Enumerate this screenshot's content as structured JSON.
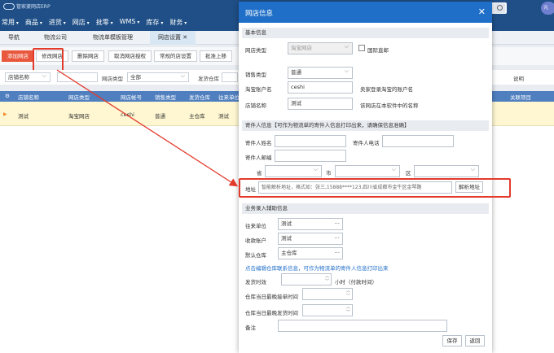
{
  "app": {
    "logo_text": "管家婆网店ERP",
    "avatar_text": "元"
  },
  "topnav": [
    "常用",
    "商品",
    "进货",
    "网店",
    "批零",
    "WMS",
    "库存",
    "财务"
  ],
  "tabs": [
    "导航",
    "物流公司",
    "物流单模板管理",
    "网店设置"
  ],
  "toolbar": {
    "add": "添加网店",
    "edit": "修改网店",
    "delete": "删除网店",
    "cancel_auth": "取消网店授权",
    "hint": "常规的店设置",
    "auth": "批准上移"
  },
  "filters": {
    "shop_name_select": "店铺名称",
    "shop_type_label": "网店类型",
    "shop_type_value": "全部",
    "warehouse_label": "发货仓库",
    "right_label": "说明"
  },
  "grid": {
    "headers": [
      "店铺名称",
      "网店类型",
      "网店帐号",
      "销售类型",
      "发货仓库",
      "往来单位",
      "关联项目"
    ],
    "row": {
      "name": "测试",
      "type": "淘宝网店",
      "account": "ceshi",
      "sale": "普通",
      "warehouse": "主仓库",
      "unit": "测试"
    }
  },
  "modal": {
    "title": "网店信息",
    "basic": {
      "section": "基本信息",
      "type_label": "网店类型",
      "type_value": "淘宝网店",
      "intl_label": "国际直邮",
      "sale_label": "销售类型",
      "sale_value": "普通",
      "account_label": "淘宝账户名",
      "account_value": "ceshi",
      "account_hint": "卖家登录淘宝的账户名",
      "shop_label": "店铺名称",
      "shop_value": "测试",
      "shop_hint": "该网店在本软件中的名称"
    },
    "sender": {
      "section": "寄件人信息【可作为物流单的寄件人信息打印出来，请确保信息准确】",
      "name_label": "寄件人姓名",
      "phone_label": "寄件人电话",
      "zip_label": "寄件人邮编",
      "province_label": "省",
      "city_label": "市",
      "district_label": "区",
      "address_label": "地址",
      "address_placeholder": "智能解析地址，格式如：张三,15888****123,四川省成都市金牛区金琴路",
      "parse_button": "解析地址"
    },
    "business": {
      "section": "业务录入辅助信息",
      "unit_label": "往来单位",
      "unit_value": "测试",
      "account_label": "收款账户",
      "account_value": "测试",
      "warehouse_label": "默认仓库",
      "warehouse_value": "主仓库",
      "link": "点击编辑仓库联系信息，可作为物流单的寄件人信息打印出来",
      "timeliness_label": "发货时效",
      "timeliness_unit": "小时（付款时间）",
      "latest_order_label": "仓库当日最晚接单时间",
      "latest_ship_label": "仓库当日最晚发货时间",
      "remark_label": "备注"
    },
    "buttons": {
      "save": "保存",
      "back": "返回"
    }
  }
}
